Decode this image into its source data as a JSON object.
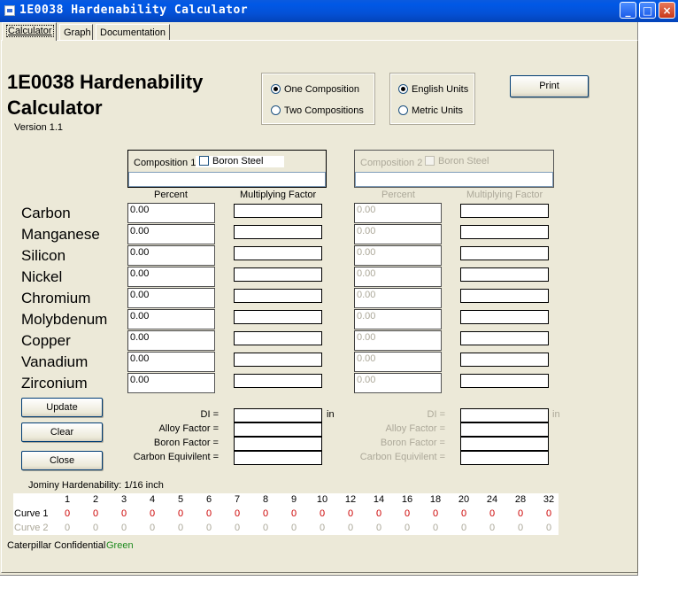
{
  "window": {
    "title": "1E0038 Hardenability Calculator",
    "icon": "app-icon",
    "controls": {
      "minimize": "_",
      "maximize": "□",
      "close": "×"
    }
  },
  "tabs": [
    "Calculator",
    "Graph",
    "Documentation"
  ],
  "header": {
    "title_line1": "1E0038 Hardenability",
    "title_line2": "Calculator",
    "version": "Version 1.1"
  },
  "composition_mode": {
    "options": [
      "One Composition",
      "Two Compositions"
    ],
    "selected": "One Composition"
  },
  "units": {
    "options": [
      "English Units",
      "Metric Units"
    ],
    "selected": "English Units"
  },
  "print_button": "Print",
  "composition1": {
    "label": "Composition 1",
    "boron_label": "Boron Steel",
    "boron_checked": false,
    "name_value": "",
    "col_percent": "Percent",
    "col_factor": "Multiplying Factor"
  },
  "composition2": {
    "label": "Composition 2",
    "boron_label": "Boron Steel",
    "boron_checked": false,
    "name_value": "",
    "col_percent": "Percent",
    "col_factor": "Multiplying Factor"
  },
  "elements": [
    {
      "name": "Carbon",
      "pct1": "0.00",
      "pct2": "0.00"
    },
    {
      "name": "Manganese",
      "pct1": "0.00",
      "pct2": "0.00"
    },
    {
      "name": "Silicon",
      "pct1": "0.00",
      "pct2": "0.00"
    },
    {
      "name": "Nickel",
      "pct1": "0.00",
      "pct2": "0.00"
    },
    {
      "name": "Chromium",
      "pct1": "0.00",
      "pct2": "0.00"
    },
    {
      "name": "Molybdenum",
      "pct1": "0.00",
      "pct2": "0.00"
    },
    {
      "name": "Copper",
      "pct1": "0.00",
      "pct2": "0.00"
    },
    {
      "name": "Vanadium",
      "pct1": "0.00",
      "pct2": "0.00"
    },
    {
      "name": "Zirconium",
      "pct1": "0.00",
      "pct2": "0.00"
    }
  ],
  "buttons": {
    "update": "Update",
    "clear": "Clear",
    "close": "Close"
  },
  "results": {
    "di_label": "DI =",
    "di_unit": "in",
    "alloy_label": "Alloy Factor =",
    "boron_label": "Boron Factor =",
    "carbon_label": "Carbon Equivilent ="
  },
  "jominy": {
    "title": "Jominy Hardenability: 1/16 inch",
    "distances": [
      "1",
      "2",
      "3",
      "4",
      "5",
      "6",
      "7",
      "8",
      "9",
      "10",
      "12",
      "14",
      "16",
      "18",
      "20",
      "24",
      "28",
      "32"
    ],
    "curve1_label": "Curve 1",
    "curve2_label": "Curve 2",
    "curve1": [
      "0",
      "0",
      "0",
      "0",
      "0",
      "0",
      "0",
      "0",
      "0",
      "0",
      "0",
      "0",
      "0",
      "0",
      "0",
      "0",
      "0",
      "0"
    ],
    "curve2": [
      "0",
      "0",
      "0",
      "0",
      "0",
      "0",
      "0",
      "0",
      "0",
      "0",
      "0",
      "0",
      "0",
      "0",
      "0",
      "0",
      "0",
      "0"
    ]
  },
  "footer": {
    "confidential": "Caterpillar Confidential",
    "status": "Green"
  },
  "colors": {
    "curve1": "#cc0000",
    "status": "#1e8a1e",
    "disabled": "#aca899"
  }
}
